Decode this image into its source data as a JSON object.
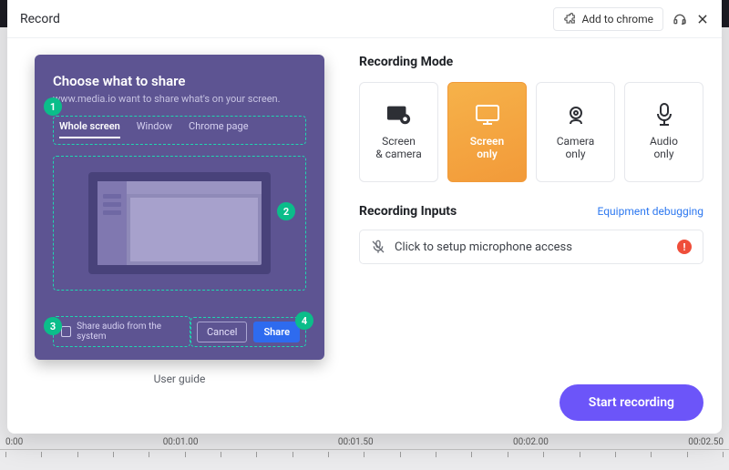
{
  "header": {
    "title": "Record",
    "add_to_chrome": "Add to chrome"
  },
  "share_panel": {
    "title": "Choose what to share",
    "subtitle": "www.media.io want to share what's on your screen.",
    "tabs": {
      "whole": "Whole screen",
      "window": "Window",
      "page": "Chrome page"
    },
    "share_audio": "Share audio from the system",
    "cancel": "Cancel",
    "share": "Share",
    "badges": {
      "n1": "1",
      "n2": "2",
      "n3": "3",
      "n4": "4"
    }
  },
  "user_guide": "User guide",
  "modes": {
    "heading": "Recording Mode",
    "screen_camera": "Screen\n& camera",
    "screen_only": "Screen\nonly",
    "camera_only": "Camera\nonly",
    "audio_only": "Audio\nonly"
  },
  "inputs": {
    "heading": "Recording Inputs",
    "equipment_link": "Equipment debugging",
    "setup_mic": "Click to setup microphone access",
    "warn": "!"
  },
  "start": "Start recording",
  "timeline": {
    "t0": "0:00",
    "t1": "00:01.00",
    "t2": "00:01.50",
    "t3": "00:02.00",
    "t4": "00:02.50"
  }
}
